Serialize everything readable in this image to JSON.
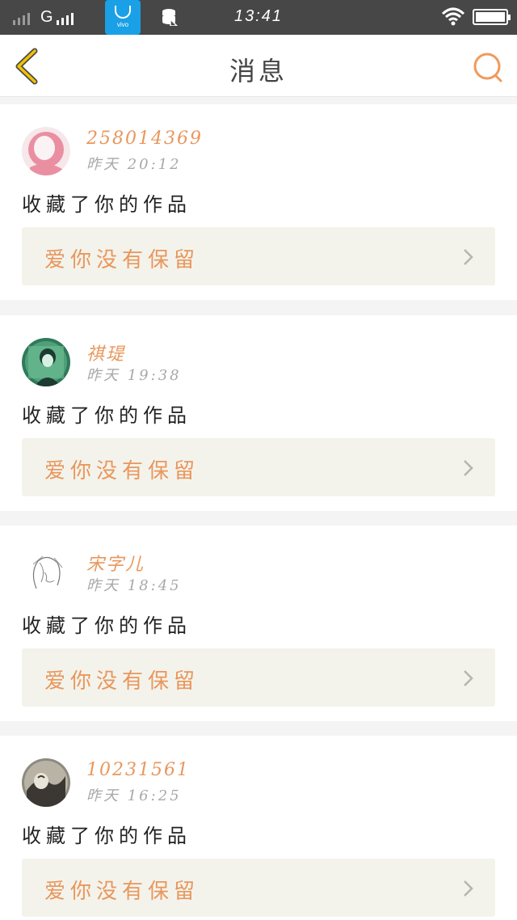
{
  "status_bar": {
    "network": "G",
    "app_badge": "vivo",
    "time": "13:41"
  },
  "header": {
    "title": "消息"
  },
  "notifications": [
    {
      "user": "258014369",
      "time": "昨天 20:12",
      "action": "收藏了你的作品",
      "work": "爱你没有保留"
    },
    {
      "user": "祺瑅",
      "time": "昨天 19:38",
      "action": "收藏了你的作品",
      "work": "爱你没有保留"
    },
    {
      "user": "宋字儿",
      "time": "昨天 18:45",
      "action": "收藏了你的作品",
      "work": "爱你没有保留"
    },
    {
      "user": "10231561",
      "time": "昨天 16:25",
      "action": "收藏了你的作品",
      "work": "爱你没有保留"
    }
  ],
  "colors": {
    "accent": "#e9975c",
    "status_bar": "#474747",
    "link_bg": "#f3f3ec",
    "app_badge": "#1aa0e6"
  },
  "icons": {
    "back": "chevron-left-icon",
    "search": "search-icon",
    "link_arrow": "chevron-right-icon"
  }
}
